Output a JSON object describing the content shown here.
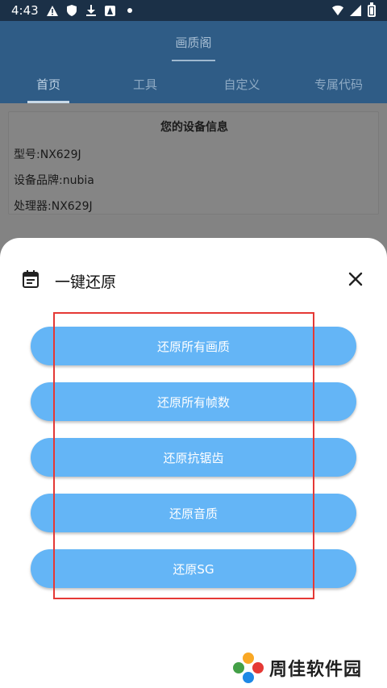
{
  "status_bar": {
    "time": "4:43",
    "icons_left": [
      "alert-icon",
      "shield-icon",
      "download-icon",
      "app-icon",
      "dot-icon"
    ],
    "icons_right": [
      "wifi-icon",
      "signal-icon",
      "battery-icon"
    ]
  },
  "header": {
    "title": "画质阁",
    "tabs": [
      {
        "label": "首页",
        "active": true
      },
      {
        "label": "工具",
        "active": false
      },
      {
        "label": "自定义",
        "active": false
      },
      {
        "label": "专属代码",
        "active": false
      }
    ]
  },
  "device_info": {
    "title": "您的设备信息",
    "model": "型号:NX629J",
    "brand": "设备品牌:nubia",
    "processor": "处理器:NX629J"
  },
  "sheet": {
    "title": "一键还原",
    "buttons": [
      {
        "label": "还原所有画质"
      },
      {
        "label": "还原所有帧数"
      },
      {
        "label": "还原抗锯齿"
      },
      {
        "label": "还原音质"
      },
      {
        "label": "还原SG"
      }
    ]
  },
  "watermark": {
    "text": "周佳软件园"
  },
  "colors": {
    "status_bar": "#1b3047",
    "header": "#2f5c86",
    "button": "#64b5f6",
    "highlight": "#e53935"
  }
}
